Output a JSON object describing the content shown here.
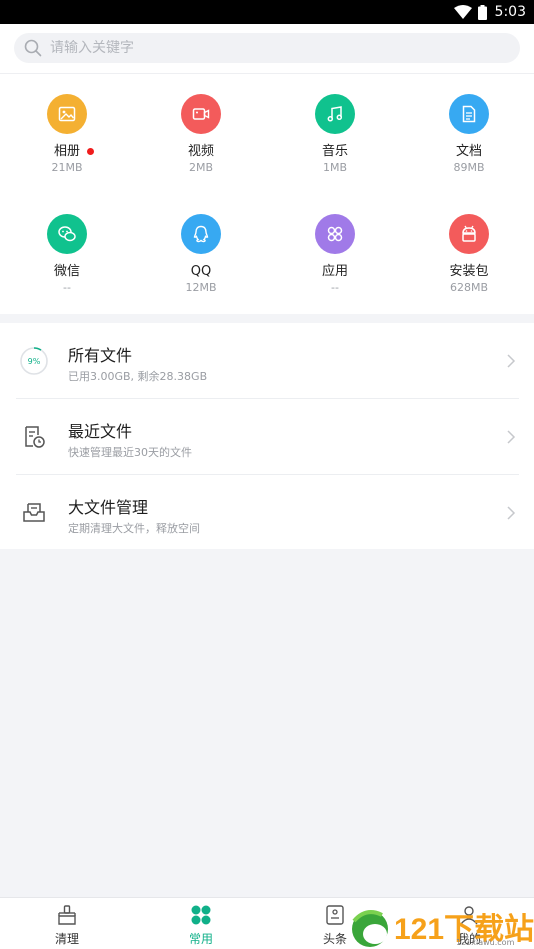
{
  "status_bar": {
    "time": "5:03"
  },
  "search": {
    "placeholder": "请输入关键字"
  },
  "categories": [
    {
      "name": "相册",
      "size": "21MB",
      "icon": "photo-icon",
      "color": "#f4b032",
      "badge": true
    },
    {
      "name": "视频",
      "size": "2MB",
      "icon": "video-icon",
      "color": "#f35b5b"
    },
    {
      "name": "音乐",
      "size": "1MB",
      "icon": "music-icon",
      "color": "#10c28e"
    },
    {
      "name": "文档",
      "size": "89MB",
      "icon": "document-icon",
      "color": "#37a9f2"
    },
    {
      "name": "微信",
      "size": "--",
      "icon": "wechat-icon",
      "color": "#10c28e"
    },
    {
      "name": "QQ",
      "size": "12MB",
      "icon": "qq-icon",
      "color": "#37a9f2"
    },
    {
      "name": "应用",
      "size": "--",
      "icon": "apps-icon",
      "color": "#a07ae8"
    },
    {
      "name": "安装包",
      "size": "628MB",
      "icon": "android-icon",
      "color": "#f35b5b"
    }
  ],
  "storage": {
    "percent_label": "9%",
    "percent": 9
  },
  "list": [
    {
      "title": "所有文件",
      "subtitle": "已用3.00GB, 剩余28.38GB",
      "icon": "storage-ring-icon"
    },
    {
      "title": "最近文件",
      "subtitle": "快速管理最近30天的文件",
      "icon": "recent-file-icon"
    },
    {
      "title": "大文件管理",
      "subtitle": "定期清理大文件，释放空间",
      "icon": "inbox-tray-icon"
    }
  ],
  "bottom_nav": [
    {
      "label": "清理",
      "icon": "broom-icon",
      "active": false
    },
    {
      "label": "常用",
      "icon": "grid-dots-icon",
      "active": true
    },
    {
      "label": "头条",
      "icon": "news-icon",
      "active": false
    },
    {
      "label": "我的",
      "icon": "profile-icon",
      "active": false
    }
  ],
  "watermark": {
    "brand": "121下载站",
    "url": "121xiawu.com"
  },
  "colors": {
    "accent": "#10b089",
    "badge": "#f01c1c"
  }
}
